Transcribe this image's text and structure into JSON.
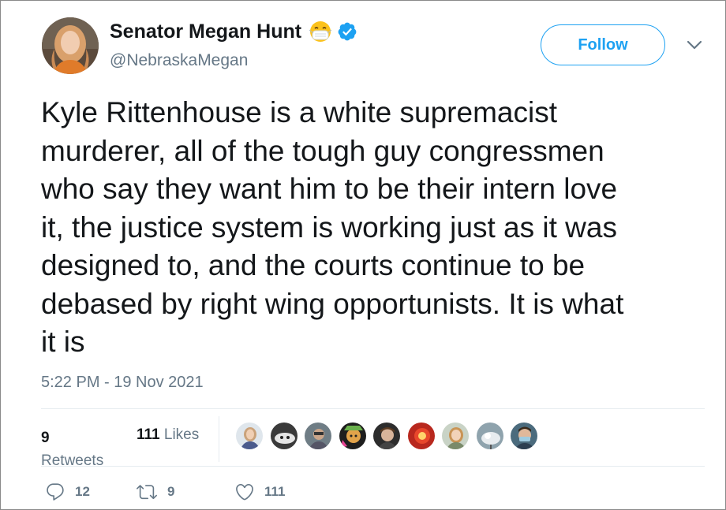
{
  "colors": {
    "accent": "#1da1f2",
    "text_primary": "#14171a",
    "text_secondary": "#657786",
    "divider": "#e6ecf0"
  },
  "author": {
    "display_name": "Senator Megan Hunt",
    "handle": "@NebraskaMegan",
    "name_emoji": "face-with-medical-mask-icon",
    "verified_icon": "verified-badge-icon"
  },
  "follow_button": {
    "label": "Follow"
  },
  "menu": {
    "icon": "chevron-down-icon"
  },
  "tweet": {
    "text": "Kyle Rittenhouse is a white supremacist\nmurderer, all of the tough guy congressmen\nwho say they want him to be their intern love\nit, the justice system is working just as it was\ndesigned to, and the courts continue to be\ndebased by right wing opportunists. It is what\nit is",
    "timestamp": "5:22 PM - 19 Nov 2021"
  },
  "stats": {
    "retweets_count": "9",
    "retweets_label": "Retweets",
    "likes_count": "111",
    "likes_label": "Likes"
  },
  "actions": {
    "reply_count": "12",
    "retweet_count": "9",
    "like_count": "111",
    "reply_icon": "reply-icon",
    "retweet_icon": "retweet-icon",
    "like_icon": "heart-icon"
  }
}
